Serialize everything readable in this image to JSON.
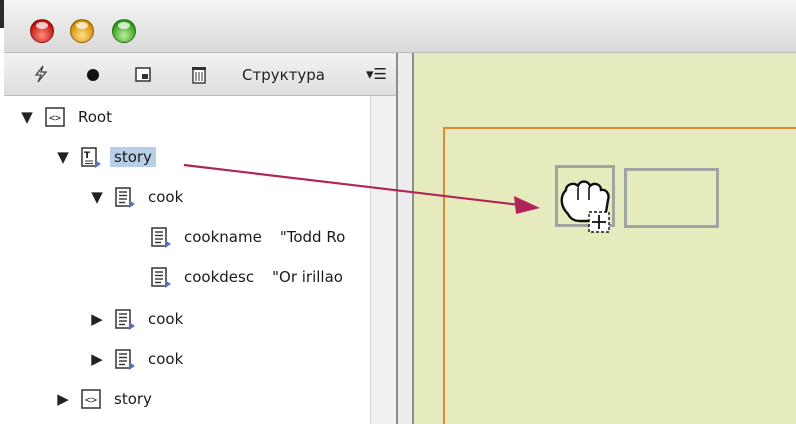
{
  "toolbar": {
    "title": "Структура",
    "menu_icon": "▾☰",
    "icons": [
      "lightning-icon",
      "bullet-icon",
      "new-element-icon",
      "delete-icon"
    ]
  },
  "tree": [
    {
      "label": "Root",
      "value": "",
      "expanded": true,
      "icon": "xml-tag-icon",
      "selected": false
    },
    {
      "label": "story",
      "value": "",
      "expanded": true,
      "icon": "text-story-icon",
      "selected": true
    },
    {
      "label": "cook",
      "value": "",
      "expanded": true,
      "icon": "element-icon",
      "selected": false
    },
    {
      "label": "cookname",
      "value": "\"Todd Ro",
      "expanded": null,
      "icon": "element-icon",
      "selected": false
    },
    {
      "label": "cookdesc",
      "value": "\"Or irillao",
      "expanded": null,
      "icon": "element-icon",
      "selected": false
    },
    {
      "label": "cook",
      "value": "",
      "expanded": false,
      "icon": "element-icon",
      "selected": false
    },
    {
      "label": "cook",
      "value": "",
      "expanded": false,
      "icon": "element-icon",
      "selected": false
    },
    {
      "label": "story",
      "value": "",
      "expanded": false,
      "icon": "xml-tag-icon",
      "selected": false
    }
  ],
  "colors": {
    "canvas": "#e6ebbd",
    "page_margin": "#e08a35",
    "arrow": "#b1245a",
    "selection": "#b7cfe9"
  }
}
